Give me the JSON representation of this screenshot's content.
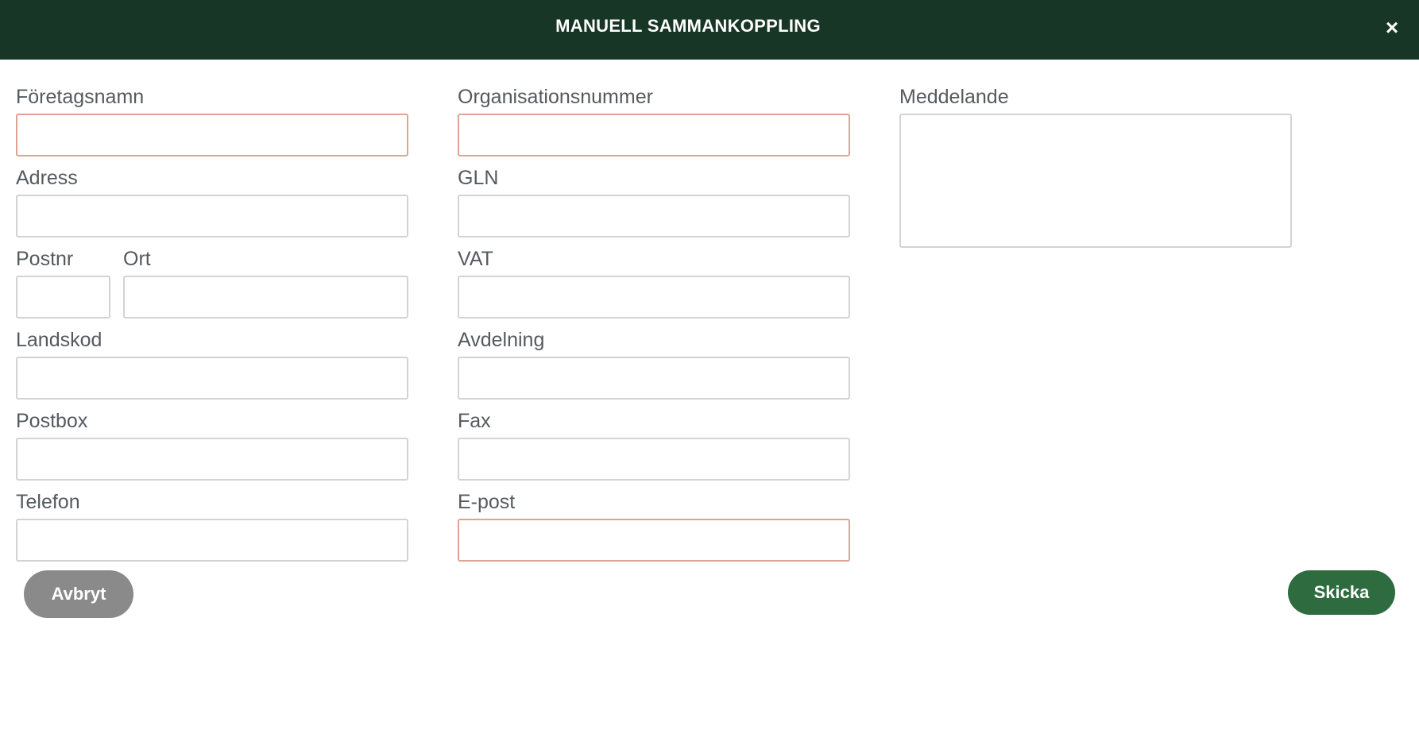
{
  "dialog": {
    "title": "MANUELL SAMMANKOPPLING",
    "close_label": "×"
  },
  "form": {
    "company_name": {
      "label": "Företagsnamn",
      "value": ""
    },
    "org_number": {
      "label": "Organisationsnummer",
      "value": ""
    },
    "message": {
      "label": "Meddelande",
      "value": ""
    },
    "address": {
      "label": "Adress",
      "value": ""
    },
    "gln": {
      "label": "GLN",
      "value": ""
    },
    "postal_code": {
      "label": "Postnr",
      "value": ""
    },
    "city": {
      "label": "Ort",
      "value": ""
    },
    "vat": {
      "label": "VAT",
      "value": ""
    },
    "country_code": {
      "label": "Landskod",
      "value": ""
    },
    "department": {
      "label": "Avdelning",
      "value": ""
    },
    "postbox": {
      "label": "Postbox",
      "value": ""
    },
    "fax": {
      "label": "Fax",
      "value": ""
    },
    "phone": {
      "label": "Telefon",
      "value": ""
    },
    "email": {
      "label": "E-post",
      "value": ""
    }
  },
  "buttons": {
    "cancel": "Avbryt",
    "send": "Skicka"
  },
  "colors": {
    "header_bg": "#173625",
    "required_border": "#dea392",
    "send_bg": "#2e6b3e",
    "cancel_bg": "#8a8a8a"
  }
}
